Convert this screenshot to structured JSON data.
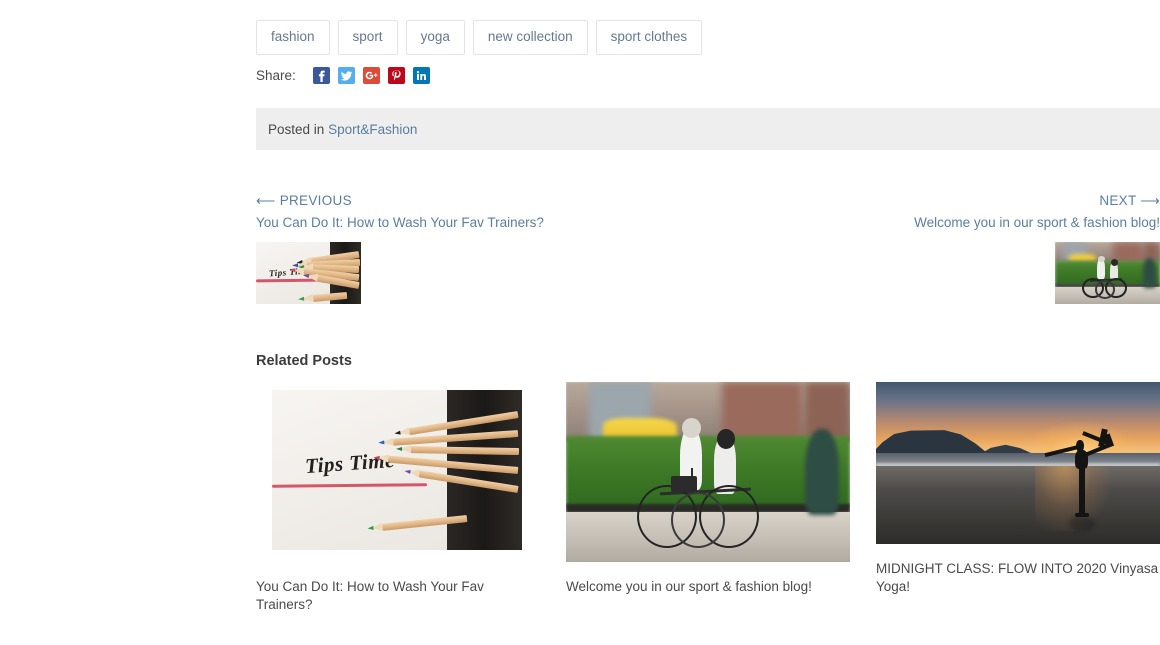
{
  "tags": [
    {
      "label": "fashion"
    },
    {
      "label": "sport"
    },
    {
      "label": "yoga"
    },
    {
      "label": "new collection"
    },
    {
      "label": "sport clothes"
    }
  ],
  "share": {
    "label": "Share:",
    "icons": [
      {
        "name": "facebook-share-icon",
        "glyph": "f",
        "color": "#3b5998"
      },
      {
        "name": "twitter-share-icon",
        "glyph": "t",
        "color": "#55acee"
      },
      {
        "name": "google-plus-share-icon",
        "glyph": "g+",
        "color": "#dd4b39"
      },
      {
        "name": "pinterest-share-icon",
        "glyph": "p",
        "color": "#bd081c"
      },
      {
        "name": "linkedin-share-icon",
        "glyph": "in",
        "color": "#0077b5"
      }
    ]
  },
  "posted": {
    "prefix": "Posted in",
    "category": "Sport&Fashion",
    "background": "#eeeeee",
    "link_color": "#5b7e9e"
  },
  "post_nav": {
    "previous": {
      "kicker": "⟵ PREVIOUS",
      "title": "You Can Do It: How to Wash Your Fav Trainers?",
      "thumb_alt": "tips-time-pencils"
    },
    "next": {
      "kicker": "NEXT ⟶",
      "title": "Welcome you in our sport & fashion blog!",
      "thumb_alt": "cyclists-in-city"
    }
  },
  "related": {
    "heading": "Related Posts",
    "posts": [
      {
        "title": "You Can Do It: How to Wash Your Fav Trainers?",
        "image_alt": "tips-time-pencils",
        "image_caption": "Tips Time"
      },
      {
        "title": "Welcome you in our sport & fashion blog!",
        "image_alt": "cyclists-in-city"
      },
      {
        "title": "MIDNIGHT CLASS: FLOW INTO 2020 Vinyasa Yoga!",
        "image_alt": "yoga-beach-sunset"
      }
    ]
  }
}
